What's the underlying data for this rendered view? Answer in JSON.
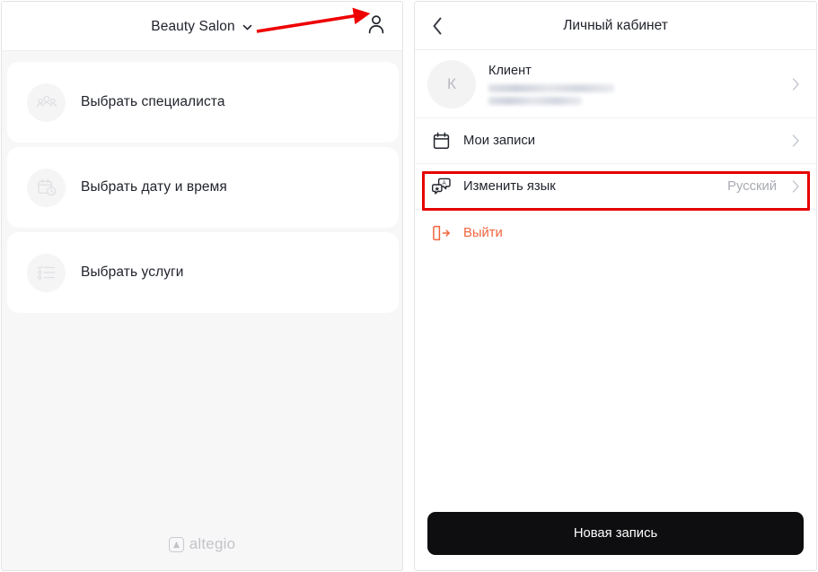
{
  "left_panel": {
    "header": {
      "salon_name": "Beauty Salon",
      "dropdown_icon": "chevron-down-icon",
      "profile_icon": "user-account-icon"
    },
    "menu_cards": [
      {
        "label": "Выбрать специалиста",
        "icon": "people-group-icon"
      },
      {
        "label": "Выбрать дату и время",
        "icon": "calendar-clock-icon"
      },
      {
        "label": "Выбрать услуги",
        "icon": "checklist-icon"
      }
    ],
    "footer": {
      "logo_text": "altegio",
      "logo_icon": "altegio-mark-icon"
    }
  },
  "right_panel": {
    "header": {
      "title": "Личный кабинет",
      "back_icon": "chevron-left-icon"
    },
    "profile": {
      "avatar_initial": "К",
      "name": "Клиент",
      "details_redacted": true,
      "chevron_icon": "chevron-right-icon"
    },
    "settings_rows": [
      {
        "label": "Мои записи",
        "icon": "calendar-icon",
        "value": "",
        "chevron_icon": "chevron-right-icon",
        "highlighted": false
      },
      {
        "label": "Изменить язык",
        "icon": "translate-icon",
        "value": "Русский",
        "chevron_icon": "chevron-right-icon",
        "highlighted": true
      },
      {
        "label": "Выйти",
        "icon": "logout-icon",
        "value": "",
        "chevron_icon": "",
        "highlighted": false
      }
    ],
    "cta": {
      "label": "Новая запись"
    }
  },
  "annotations": {
    "arrow": {
      "name": "red-arrow-pointing-to-profile-icon",
      "color": "#EE0000"
    },
    "highlight_box": {
      "name": "red-highlight-change-language",
      "color": "#E60000"
    }
  },
  "colors": {
    "accent_orange": "#F2653D",
    "annotation_red": "#EE0000",
    "cta_black": "#0E0E10",
    "panel_bg": "#F7F7F8",
    "text_primary": "#21242C",
    "text_muted": "#A9ABB3"
  }
}
